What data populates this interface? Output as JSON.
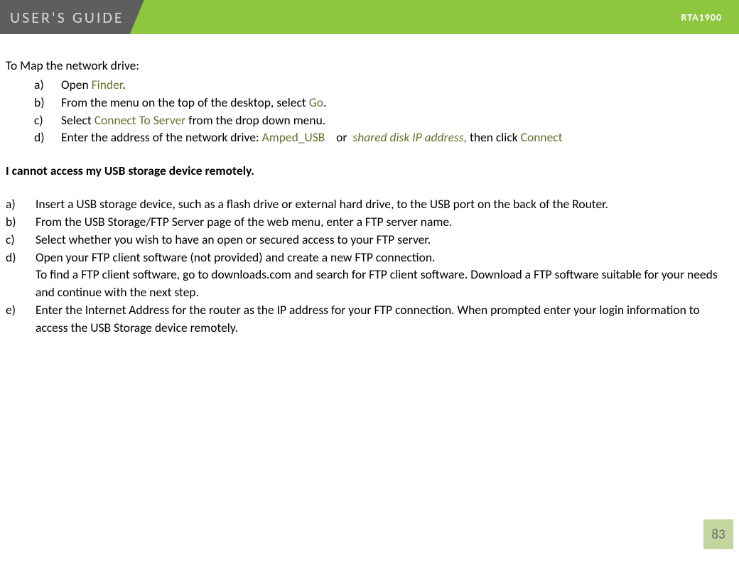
{
  "header": {
    "title": "USER'S GUIDE",
    "model": "RTA1900"
  },
  "section1": {
    "intro": "To Map the network drive:",
    "items": [
      {
        "marker": "a)",
        "pre": "Open ",
        "green1": "Finder",
        "post": "."
      },
      {
        "marker": "b)",
        "pre": "From the menu on the top of the desktop, select ",
        "green1": "Go",
        "post": "."
      },
      {
        "marker": "c)",
        "pre": "Select ",
        "green1": "Connect To Server",
        "post": " from the drop down menu."
      },
      {
        "marker": "d)",
        "pre": "Enter the address of the network drive: ",
        "green1": "Amped_USB",
        "mid": "    or  ",
        "greenItalic": "shared disk IP address,",
        "mid2": "  then click ",
        "green2": "Connect"
      }
    ]
  },
  "faq": {
    "heading": "I cannot access my USB storage device remotely.",
    "items": [
      {
        "marker": "a)",
        "text": "Insert a USB storage device, such as a flash drive or external hard drive, to the USB port on the back of the Router."
      },
      {
        "marker": "b)",
        "text": "From the USB Storage/FTP Server page of the web menu, enter a FTP server name."
      },
      {
        "marker": "c)",
        "text": "Select whether you wish to have an open or secured access to your FTP server."
      },
      {
        "marker": "d)",
        "text": "Open your FTP client software (not provided) and create a new FTP connection.",
        "text2": "To find a FTP client software, go to downloads.com and search for FTP client software.  Download a FTP software suitable for your needs and continue with the next step."
      },
      {
        "marker": "e)",
        "text": "Enter the Internet Address for the router as the IP address for your FTP connection.  When prompted enter your login information to access the USB Storage device remotely."
      }
    ]
  },
  "pageNumber": "83"
}
